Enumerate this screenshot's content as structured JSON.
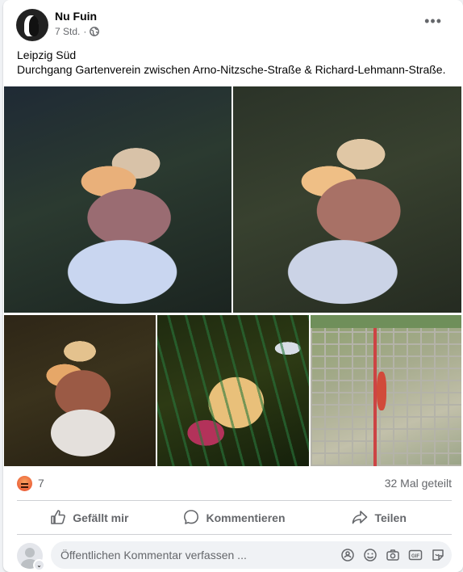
{
  "post": {
    "author": "Nu Fuin",
    "time": "7 Std.",
    "separator": "·",
    "privacy_icon": "globe-icon",
    "more_icon": "more-horizontal-icon",
    "text_line1": "Leipzig Süd",
    "text_line2": "Durchgang Gartenverein zwischen Arno-Nitzsche-Straße & Richard-Lehmann-Straße."
  },
  "photos": [
    {
      "name": "photo-1"
    },
    {
      "name": "photo-2"
    },
    {
      "name": "photo-3"
    },
    {
      "name": "photo-4"
    },
    {
      "name": "photo-5-map"
    }
  ],
  "stats": {
    "reaction_icon": "angry-reaction-icon",
    "reaction_count": "7",
    "shares": "32 Mal geteilt"
  },
  "actions": {
    "like": "Gefällt mir",
    "comment": "Kommentieren",
    "share": "Teilen"
  },
  "comment": {
    "placeholder": "Öffentlichen Kommentar verfassen ...",
    "icons": [
      "avatar-sticker-icon",
      "emoji-icon",
      "camera-icon",
      "gif-icon",
      "sticker-icon"
    ]
  },
  "colors": {
    "secondary_text": "#65676b",
    "divider": "#ced0d4",
    "comment_bg": "#f0f2f5",
    "angry_reaction": "#e84a2d"
  }
}
